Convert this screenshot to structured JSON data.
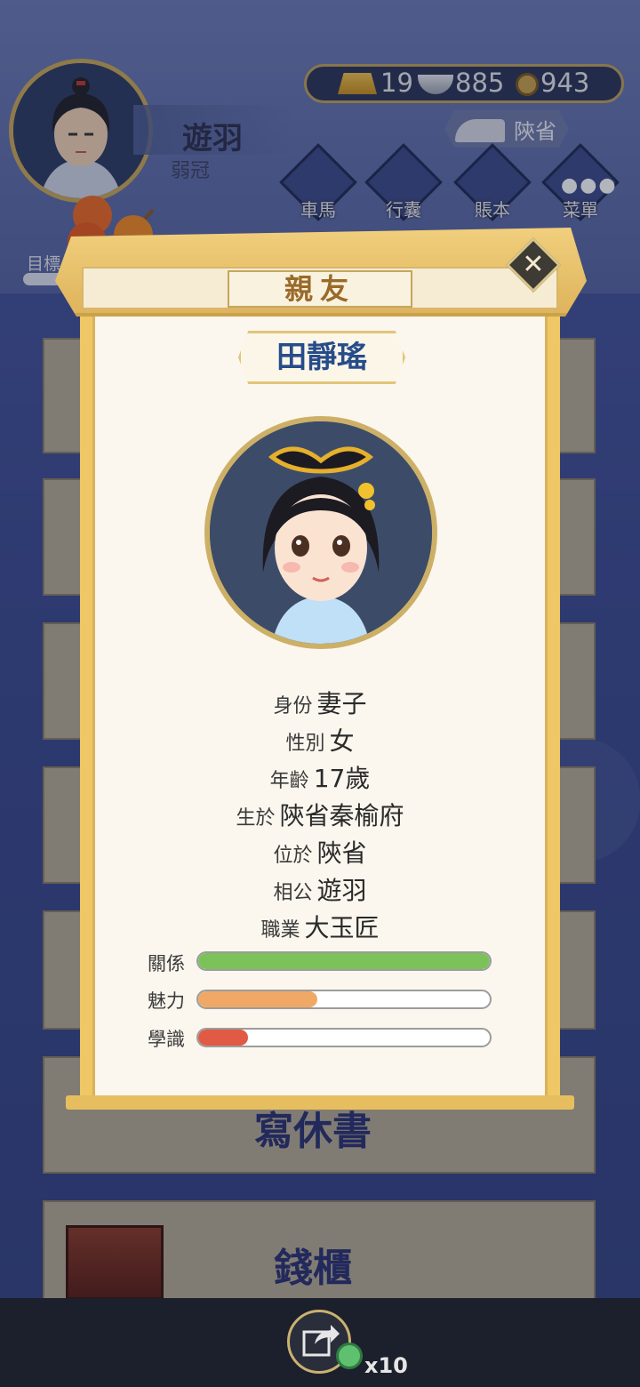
{
  "player": {
    "name": "遊羽",
    "title": "弱冠"
  },
  "currency": {
    "gold": "19",
    "silver": "885",
    "coin": "943"
  },
  "location": {
    "label": "陝省"
  },
  "nav": [
    {
      "label": "車馬",
      "icon": "carriage-icon"
    },
    {
      "label": "行囊",
      "icon": "bag-icon"
    },
    {
      "label": "賬本",
      "icon": "ledger-icon"
    },
    {
      "label": "菜單",
      "icon": "more-icon"
    }
  ],
  "goal": {
    "label": "目標"
  },
  "background_cards": [
    {
      "label": "寫休書"
    },
    {
      "label": "錢櫃"
    }
  ],
  "share": {
    "count": "x10"
  },
  "modal": {
    "title": "親友",
    "person": {
      "name": "田靜瑤",
      "fields": [
        {
          "label": "身份",
          "value": "妻子"
        },
        {
          "label": "性別",
          "value": "女"
        },
        {
          "label": "年齡",
          "value": "17歲"
        },
        {
          "label": "生於",
          "value": "陝省秦榆府"
        },
        {
          "label": "位於",
          "value": "陝省"
        },
        {
          "label": "相公",
          "value": "遊羽"
        },
        {
          "label": "職業",
          "value": "大玉匠"
        }
      ],
      "stats": [
        {
          "label": "關係",
          "value": 1.0,
          "color": "#7bc25a"
        },
        {
          "label": "魅力",
          "value": 0.41,
          "color": "#f0a866"
        },
        {
          "label": "學識",
          "value": 0.17,
          "color": "#e05a44"
        }
      ]
    }
  }
}
